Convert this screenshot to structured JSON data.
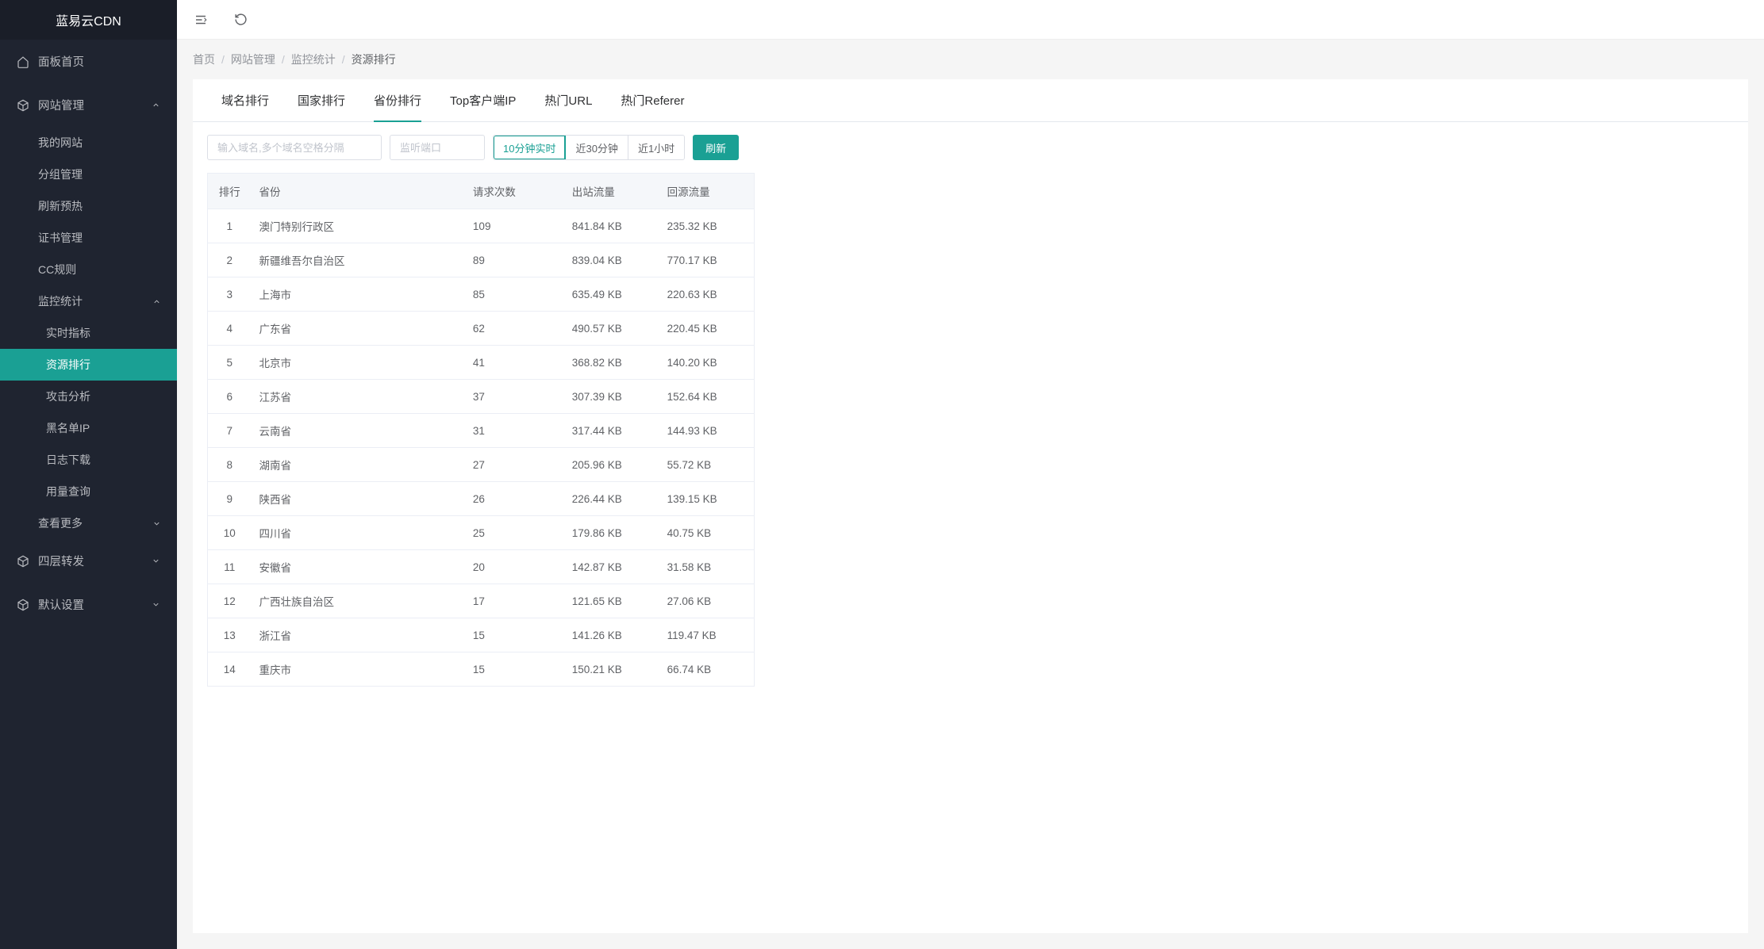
{
  "logo": "蓝易云CDN",
  "sidebar": {
    "items": [
      {
        "label": "面板首页",
        "icon": "home"
      },
      {
        "label": "网站管理",
        "icon": "box",
        "expanded": true,
        "children": [
          {
            "label": "我的网站"
          },
          {
            "label": "分组管理"
          },
          {
            "label": "刷新预热"
          },
          {
            "label": "证书管理"
          },
          {
            "label": "CC规则"
          },
          {
            "label": "监控统计",
            "expanded": true,
            "children": [
              {
                "label": "实时指标"
              },
              {
                "label": "资源排行",
                "active": true
              },
              {
                "label": "攻击分析"
              },
              {
                "label": "黑名单IP"
              },
              {
                "label": "日志下载"
              },
              {
                "label": "用量查询"
              }
            ]
          },
          {
            "label": "查看更多",
            "arrow": "down"
          }
        ]
      },
      {
        "label": "四层转发",
        "icon": "box",
        "arrow": "down"
      },
      {
        "label": "默认设置",
        "icon": "box",
        "arrow": "down"
      }
    ]
  },
  "breadcrumb": [
    "首页",
    "网站管理",
    "监控统计",
    "资源排行"
  ],
  "tabs": [
    {
      "label": "域名排行"
    },
    {
      "label": "国家排行"
    },
    {
      "label": "省份排行",
      "active": true
    },
    {
      "label": "Top客户端IP"
    },
    {
      "label": "热门URL"
    },
    {
      "label": "热门Referer"
    }
  ],
  "filters": {
    "domain_placeholder": "输入域名,多个域名空格分隔",
    "port_placeholder": "监听端口",
    "segments": [
      {
        "label": "10分钟实时",
        "active": true
      },
      {
        "label": "近30分钟"
      },
      {
        "label": "近1小时"
      }
    ],
    "refresh_label": "刷新"
  },
  "table": {
    "headers": [
      "排行",
      "省份",
      "请求次数",
      "出站流量",
      "回源流量"
    ],
    "rows": [
      [
        "1",
        "澳门特别行政区",
        "109",
        "841.84 KB",
        "235.32 KB"
      ],
      [
        "2",
        "新疆维吾尔自治区",
        "89",
        "839.04 KB",
        "770.17 KB"
      ],
      [
        "3",
        "上海市",
        "85",
        "635.49 KB",
        "220.63 KB"
      ],
      [
        "4",
        "广东省",
        "62",
        "490.57 KB",
        "220.45 KB"
      ],
      [
        "5",
        "北京市",
        "41",
        "368.82 KB",
        "140.20 KB"
      ],
      [
        "6",
        "江苏省",
        "37",
        "307.39 KB",
        "152.64 KB"
      ],
      [
        "7",
        "云南省",
        "31",
        "317.44 KB",
        "144.93 KB"
      ],
      [
        "8",
        "湖南省",
        "27",
        "205.96 KB",
        "55.72 KB"
      ],
      [
        "9",
        "陕西省",
        "26",
        "226.44 KB",
        "139.15 KB"
      ],
      [
        "10",
        "四川省",
        "25",
        "179.86 KB",
        "40.75 KB"
      ],
      [
        "11",
        "安徽省",
        "20",
        "142.87 KB",
        "31.58 KB"
      ],
      [
        "12",
        "广西壮族自治区",
        "17",
        "121.65 KB",
        "27.06 KB"
      ],
      [
        "13",
        "浙江省",
        "15",
        "141.26 KB",
        "119.47 KB"
      ],
      [
        "14",
        "重庆市",
        "15",
        "150.21 KB",
        "66.74 KB"
      ]
    ]
  }
}
